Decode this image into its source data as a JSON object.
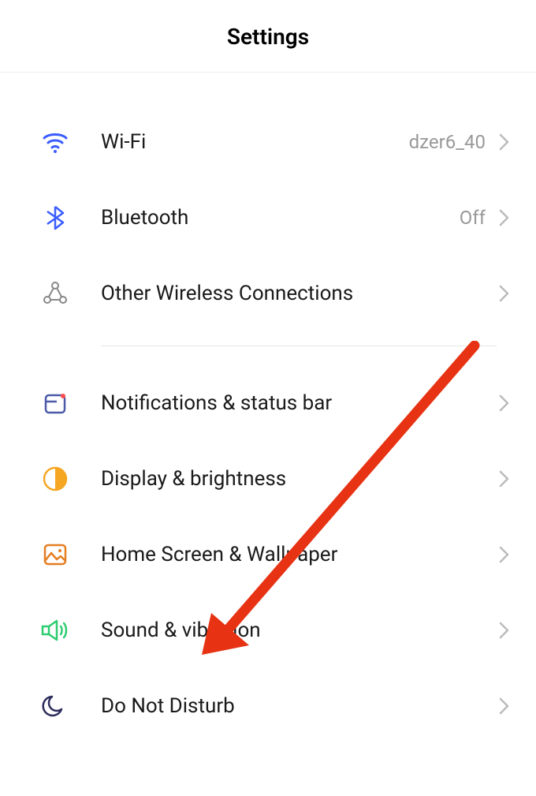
{
  "header": {
    "title": "Settings"
  },
  "groups": [
    {
      "items": [
        {
          "id": "wifi",
          "label": "Wi-Fi",
          "value": "dzer6_40"
        },
        {
          "id": "bluetooth",
          "label": "Bluetooth",
          "value": "Off"
        },
        {
          "id": "other-wireless",
          "label": "Other Wireless Connections",
          "value": ""
        }
      ]
    },
    {
      "items": [
        {
          "id": "notifications",
          "label": "Notifications & status bar",
          "value": ""
        },
        {
          "id": "display",
          "label": "Display & brightness",
          "value": ""
        },
        {
          "id": "home-screen",
          "label": "Home Screen & Wallpaper",
          "value": ""
        },
        {
          "id": "sound",
          "label": "Sound & vibration",
          "value": ""
        },
        {
          "id": "dnd",
          "label": "Do Not Disturb",
          "value": ""
        }
      ]
    }
  ]
}
